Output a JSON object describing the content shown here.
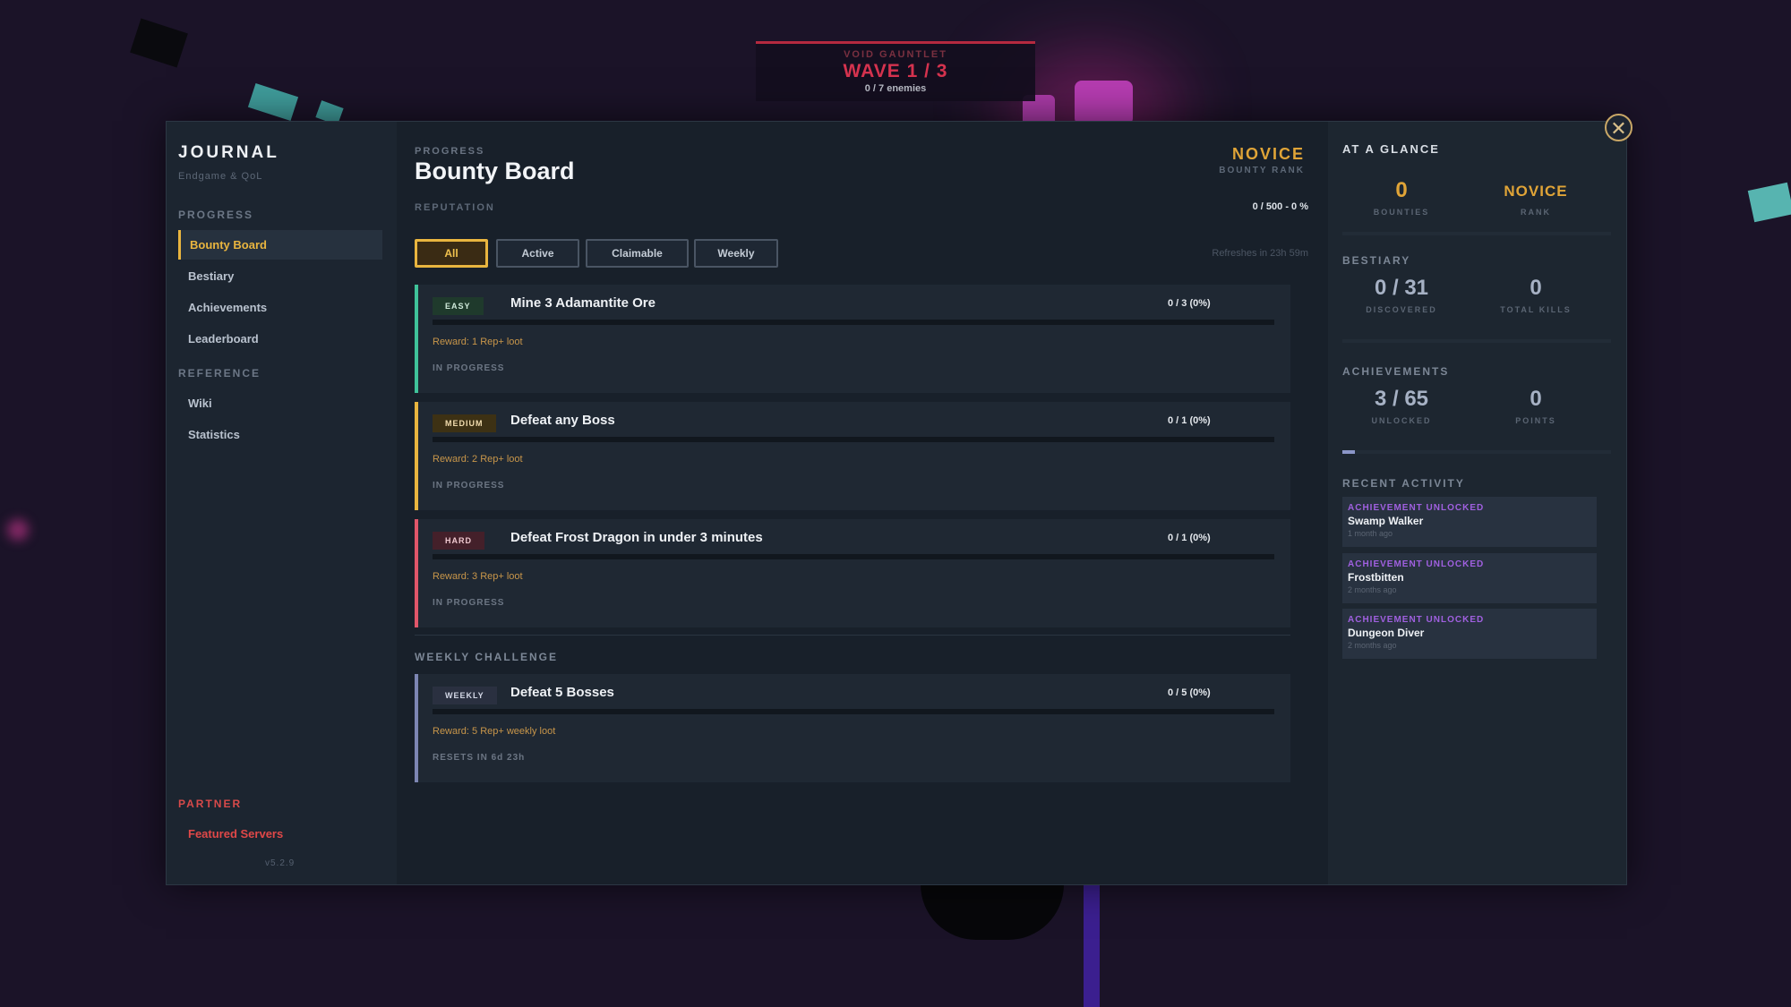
{
  "hud": {
    "label": "VOID GAUNTLET",
    "wave": "WAVE 1 / 3",
    "enemies": "0 / 7 enemies"
  },
  "sidebar": {
    "title": "JOURNAL",
    "subtitle": "Endgame & QoL",
    "sections": {
      "progress": "PROGRESS",
      "reference": "REFERENCE",
      "partner": "PARTNER"
    },
    "items": {
      "bounty_board": "Bounty Board",
      "bestiary": "Bestiary",
      "achievements": "Achievements",
      "leaderboard": "Leaderboard",
      "wiki": "Wiki",
      "statistics": "Statistics",
      "featured_servers": "Featured Servers"
    },
    "version": "v5.2.9"
  },
  "main": {
    "eyebrow": "PROGRESS",
    "title": "Bounty Board",
    "rank": "NOVICE",
    "rank_label": "BOUNTY RANK",
    "reputation_label": "REPUTATION",
    "reputation_value": "0 / 500  -  0 %",
    "reputation_fraction": 0,
    "filters": [
      "All",
      "Active",
      "Claimable",
      "Weekly"
    ],
    "active_filter": "All",
    "refresh": "Refreshes in 23h 59m",
    "bounties": [
      {
        "difficulty": "EASY",
        "title": "Mine 3 Adamantite Ore",
        "progress": "0 / 3  (0%)",
        "fraction": 0,
        "reward": "Reward:  1 Rep+  loot",
        "status": "IN PROGRESS",
        "color": "#3fc39a"
      },
      {
        "difficulty": "MEDIUM",
        "title": "Defeat any Boss",
        "progress": "0 / 1  (0%)",
        "fraction": 0,
        "reward": "Reward:  2 Rep+  loot",
        "status": "IN PROGRESS",
        "color": "#e9b53f"
      },
      {
        "difficulty": "HARD",
        "title": "Defeat Frost Dragon in under 3 minutes",
        "progress": "0 / 1  (0%)",
        "fraction": 0,
        "reward": "Reward:  3 Rep+  loot",
        "status": "IN PROGRESS",
        "color": "#e0566a"
      }
    ],
    "weekly_header": "WEEKLY CHALLENGE",
    "weekly": {
      "difficulty": "WEEKLY",
      "title": "Defeat 5 Bosses",
      "progress": "0 / 5  (0%)",
      "fraction": 0,
      "reward": "Reward:  5 Rep+  weekly loot",
      "status": "RESETS IN 6d 23h",
      "color": "#7d86b3"
    }
  },
  "glance": {
    "header": "AT A GLANCE",
    "bounties_value": "0",
    "bounties_label": "BOUNTIES",
    "rank_value": "NOVICE",
    "rank_label": "RANK",
    "bestiary_header": "BESTIARY",
    "discovered_value": "0 / 31",
    "discovered_label": "DISCOVERED",
    "kills_value": "0",
    "kills_label": "TOTAL KILLS",
    "achievements_header": "ACHIEVEMENTS",
    "unlocked_value": "3 / 65",
    "unlocked_label": "UNLOCKED",
    "points_value": "0",
    "points_label": "POINTS",
    "achievement_fraction": 0.046,
    "recent_header": "RECENT ACTIVITY",
    "activity": [
      {
        "type": "ACHIEVEMENT UNLOCKED",
        "name": "Swamp Walker",
        "when": "1 month ago"
      },
      {
        "type": "ACHIEVEMENT UNLOCKED",
        "name": "Frostbitten",
        "when": "2 months ago"
      },
      {
        "type": "ACHIEVEMENT UNLOCKED",
        "name": "Dungeon Diver",
        "when": "2 months ago"
      }
    ]
  },
  "colors": {
    "accent_gold": "#e9b53f",
    "achievement_purple": "#a060e0",
    "partner_red": "#e04848"
  }
}
